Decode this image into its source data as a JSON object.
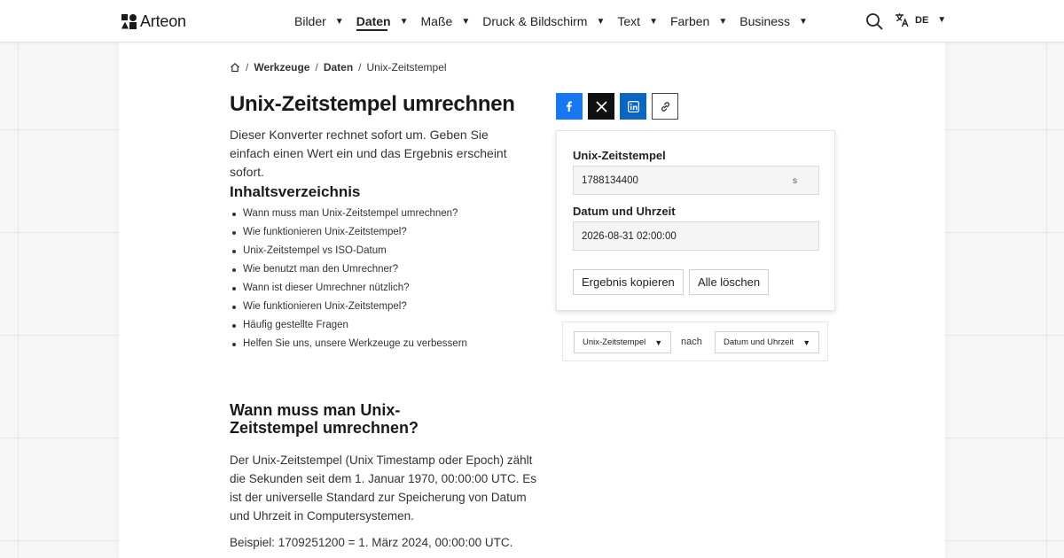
{
  "header": {
    "brand": "Arteon",
    "nav": [
      {
        "label": "Bilder",
        "active": false
      },
      {
        "label": "Daten",
        "active": true
      },
      {
        "label": "Maße",
        "active": false
      },
      {
        "label": "Druck & Bildschirm",
        "active": false
      },
      {
        "label": "Text",
        "active": false
      },
      {
        "label": "Farben",
        "active": false
      },
      {
        "label": "Business",
        "active": false
      }
    ],
    "language": "DE",
    "icons": {
      "search": "search-icon",
      "translate": "translate-icon",
      "caret": "caret-down-icon"
    }
  },
  "breadcrumb": {
    "home_icon": "home-icon",
    "items": [
      "Werkzeuge",
      "Daten",
      "Unix-Zeitstempel"
    ]
  },
  "page": {
    "title": "Unix-Zeitstempel umrechnen",
    "intro": "Dieser Konverter rechnet sofort um. Geben Sie einfach einen Wert ein und das Ergebnis erscheint sofort."
  },
  "toc": {
    "title": "Inhaltsverzeichnis",
    "items": [
      "Wann muss man Unix-Zeitstempel umrechnen?",
      "Wie funktionieren Unix-Zeitstempel?",
      "Unix-Zeitstempel vs ISO-Datum",
      "Wie benutzt man den Umrechner?",
      "Wann ist dieser Umrechner nützlich?",
      "Wie funktionieren Unix-Zeitstempel?",
      "Häufig gestellte Fragen",
      "Helfen Sie uns, unsere Werkzeuge zu verbessern"
    ]
  },
  "section": {
    "title": "Wann muss man Unix-Zeitstempel umrechnen?",
    "body": "Der Unix-Zeitstempel (Unix Timestamp oder Epoch) zählt die Sekunden seit dem 1. Januar 1970, 00:00:00 UTC. Es ist der universelle Standard zur Speicherung von Datum und Uhrzeit in Computersystemen.",
    "example": "Beispiel: 1709251200 = 1. März 2024, 00:00:00 UTC."
  },
  "share": {
    "icons": [
      "facebook-icon",
      "x-icon",
      "linkedin-icon",
      "link-icon"
    ],
    "colors": {
      "facebook": "#1877f2",
      "x": "#111111",
      "linkedin": "#0a66c2"
    }
  },
  "converter": {
    "input_label": "Unix-Zeitstempel",
    "input_value": "1788134400",
    "input_unit": "s",
    "output_label": "Datum und Uhrzeit",
    "output_value": "2026-08-31 02:00:00",
    "copy_button": "Ergebnis kopieren",
    "clear_button": "Alle löschen"
  },
  "units": {
    "from": "Unix-Zeitstempel",
    "connector": "nach",
    "to": "Datum und Uhrzeit"
  }
}
